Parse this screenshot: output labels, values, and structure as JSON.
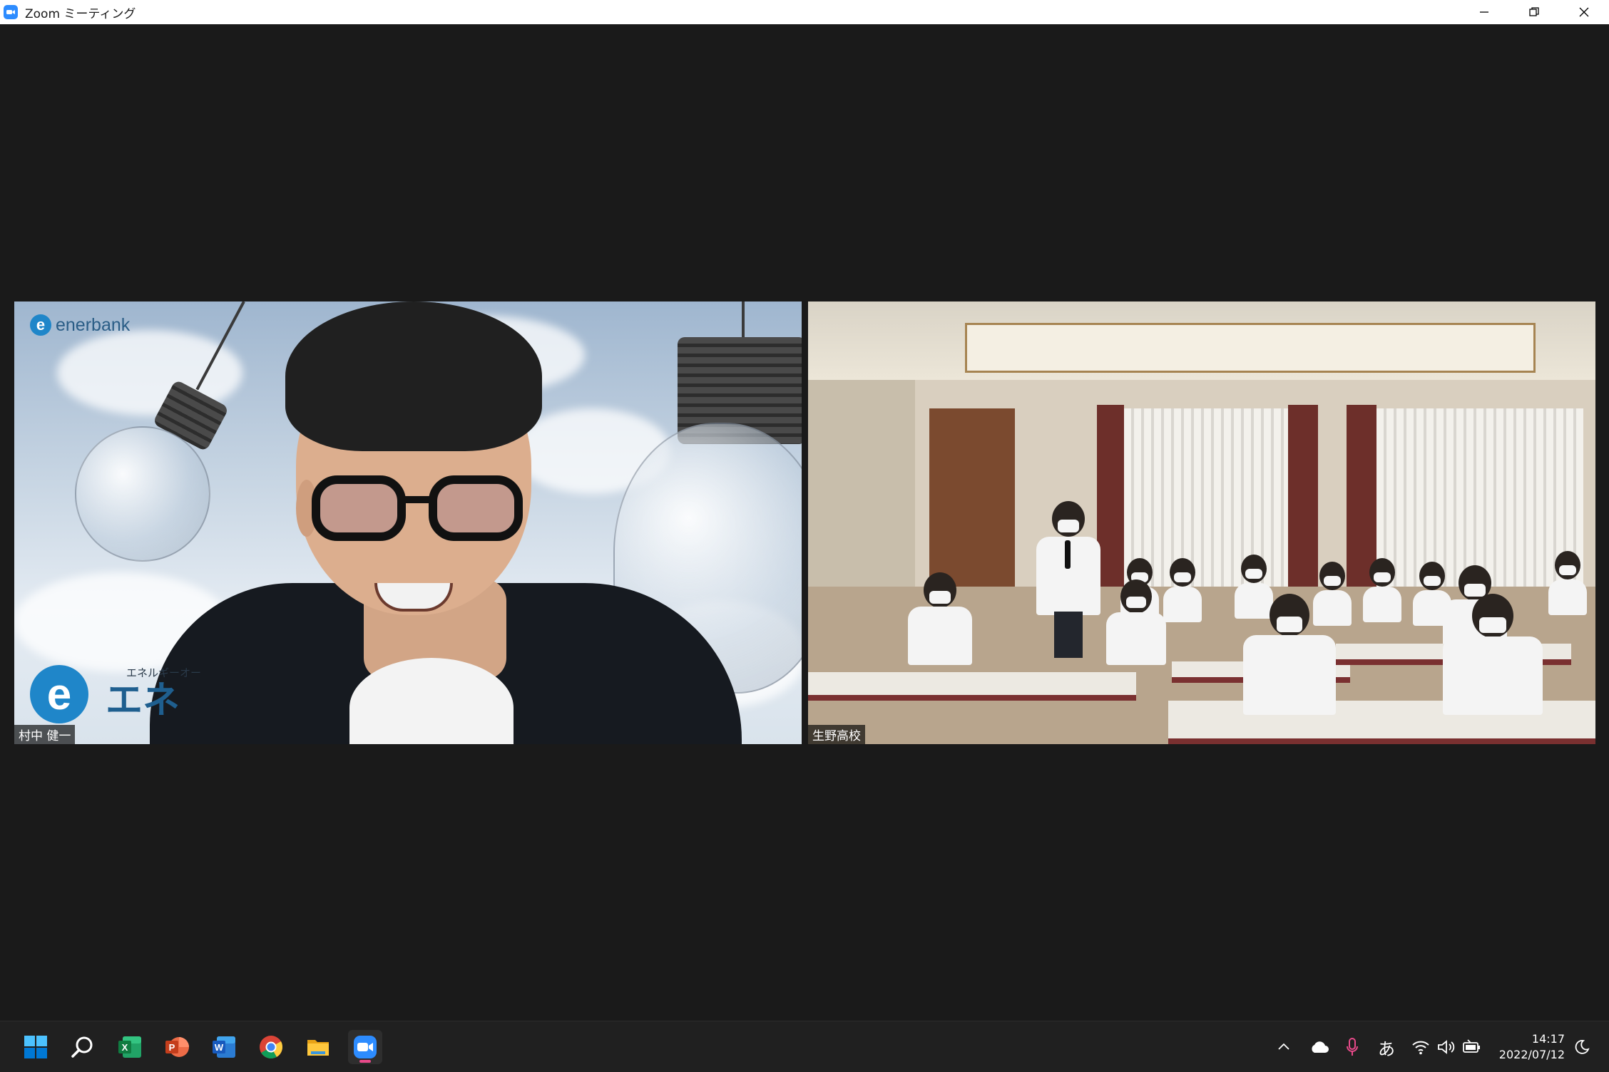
{
  "window": {
    "title": "Zoom ミーティング"
  },
  "participants": [
    {
      "name": "村中 健一"
    },
    {
      "name": "生野高校"
    }
  ],
  "left_video": {
    "brand_small": "enerbank",
    "brand_tagline": "エネルギーオー",
    "brand_name_jp": "エネ"
  },
  "taskbar": {
    "apps": [
      "start",
      "search",
      "excel",
      "powerpoint",
      "word",
      "chrome",
      "file-explorer",
      "zoom"
    ],
    "active_app": "zoom",
    "ime_label": "あ",
    "time": "14:17",
    "date": "2022/07/12"
  },
  "colors": {
    "zoom_blue": "#2d8cff",
    "taskbar_bg": "#202020",
    "meeting_bg": "#1a1a1a",
    "active_indicator": "#e84a8a"
  }
}
